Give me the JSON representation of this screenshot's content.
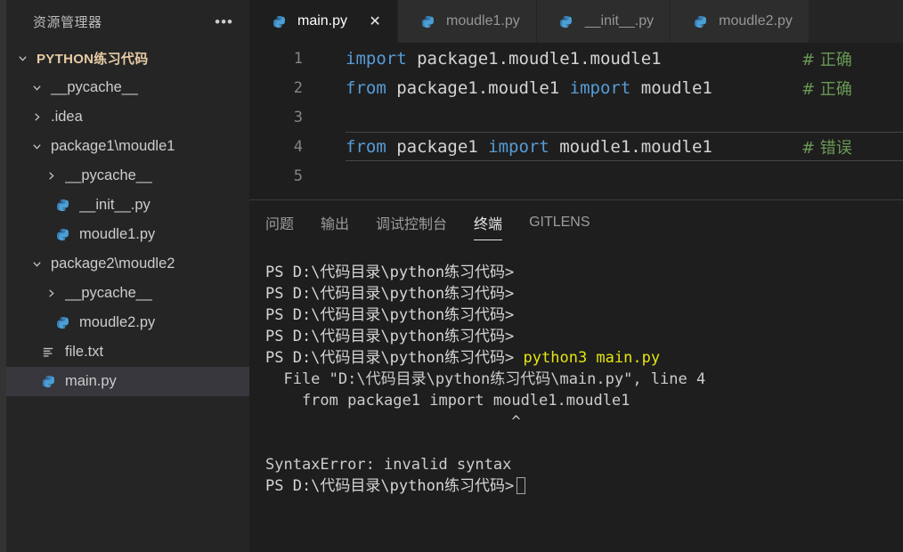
{
  "sidebar": {
    "title": "资源管理器",
    "more_label": "•••",
    "tree": [
      {
        "type": "folder",
        "label": "PYTHON练习代码",
        "expanded": true,
        "depth": 0,
        "root": true
      },
      {
        "type": "folder",
        "label": "__pycache__",
        "expanded": true,
        "depth": 1,
        "root": false
      },
      {
        "type": "folder",
        "label": ".idea",
        "expanded": false,
        "depth": 1,
        "root": false
      },
      {
        "type": "folder",
        "label": "package1\\moudle1",
        "expanded": true,
        "depth": 1,
        "root": false
      },
      {
        "type": "folder",
        "label": "__pycache__",
        "expanded": false,
        "depth": 2,
        "root": false
      },
      {
        "type": "file",
        "label": "__init__.py",
        "icon": "python-icon",
        "depth": 2
      },
      {
        "type": "file",
        "label": "moudle1.py",
        "icon": "python-icon",
        "depth": 2
      },
      {
        "type": "folder",
        "label": "package2\\moudle2",
        "expanded": true,
        "depth": 1,
        "root": false
      },
      {
        "type": "folder",
        "label": "__pycache__",
        "expanded": false,
        "depth": 2,
        "root": false
      },
      {
        "type": "file",
        "label": "moudle2.py",
        "icon": "python-icon",
        "depth": 2
      },
      {
        "type": "file",
        "label": "file.txt",
        "icon": "text-icon",
        "depth": 1
      },
      {
        "type": "file",
        "label": "main.py",
        "icon": "python-icon",
        "depth": 1,
        "selected": true
      }
    ]
  },
  "tabs": [
    {
      "label": "main.py",
      "icon": "python-icon",
      "active": true,
      "close": "✕"
    },
    {
      "label": "moudle1.py",
      "icon": "python-icon",
      "active": false
    },
    {
      "label": "__init__.py",
      "icon": "python-icon",
      "active": false
    },
    {
      "label": "moudle2.py",
      "icon": "python-icon",
      "active": false
    }
  ],
  "editor": {
    "lines": [
      {
        "num": "1",
        "current": false,
        "tokens": [
          {
            "t": "import",
            "c": "k"
          },
          {
            "t": " package1.moudle1.moudle1",
            "c": "id"
          }
        ],
        "comment": "# 正确"
      },
      {
        "num": "2",
        "current": false,
        "tokens": [
          {
            "t": "from",
            "c": "k"
          },
          {
            "t": " package1.moudle1 ",
            "c": "id"
          },
          {
            "t": "import",
            "c": "k"
          },
          {
            "t": " moudle1",
            "c": "id"
          }
        ],
        "comment": "# 正确"
      },
      {
        "num": "3",
        "current": false,
        "tokens": [],
        "comment": ""
      },
      {
        "num": "4",
        "current": true,
        "tokens": [
          {
            "t": "from",
            "c": "k"
          },
          {
            "t": " package1 ",
            "c": "id"
          },
          {
            "t": "import",
            "c": "k"
          },
          {
            "t": " moudle1.moudle1",
            "c": "id"
          }
        ],
        "comment": "# 错误"
      },
      {
        "num": "5",
        "current": false,
        "tokens": [],
        "comment": ""
      }
    ]
  },
  "panel": {
    "tabs": [
      {
        "label": "问题",
        "active": false
      },
      {
        "label": "输出",
        "active": false
      },
      {
        "label": "调试控制台",
        "active": false
      },
      {
        "label": "终端",
        "active": true
      },
      {
        "label": "GITLENS",
        "active": false
      }
    ],
    "terminal_lines": [
      {
        "prompt": "PS D:\\代码目录\\python练习代码>",
        "command": ""
      },
      {
        "prompt": "PS D:\\代码目录\\python练习代码>",
        "command": ""
      },
      {
        "prompt": "PS D:\\代码目录\\python练习代码>",
        "command": ""
      },
      {
        "prompt": "PS D:\\代码目录\\python练习代码>",
        "command": ""
      },
      {
        "prompt": "PS D:\\代码目录\\python练习代码>",
        "command": " python3 main.py"
      },
      {
        "plain": "  File \"D:\\代码目录\\python练习代码\\main.py\", line 4"
      },
      {
        "plain": "    from package1 import moudle1.moudle1"
      },
      {
        "plain": "                           ^"
      },
      {
        "plain": ""
      },
      {
        "plain": "SyntaxError: invalid syntax"
      }
    ],
    "last_prompt": "PS D:\\代码目录\\python练习代码>"
  },
  "colors": {
    "keyword": "#569cd6",
    "identifier": "#d4d4d4",
    "comment": "#6a9955",
    "command": "#e5e510",
    "root_folder": "#e7cca4",
    "selected_row": "#37373d"
  }
}
